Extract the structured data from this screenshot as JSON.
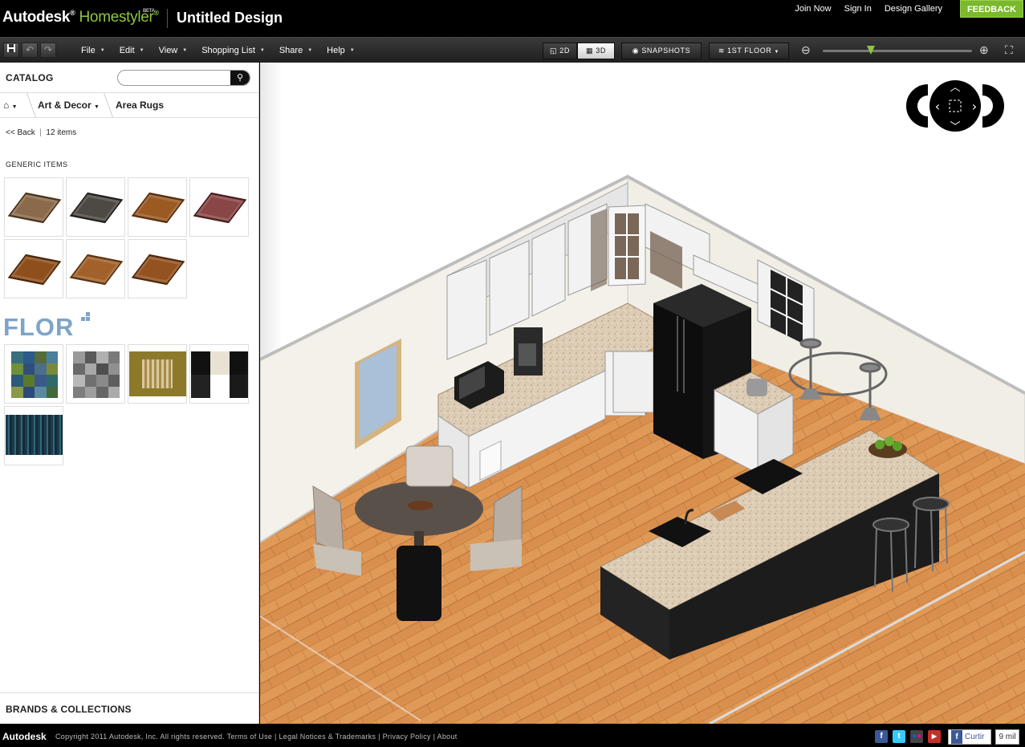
{
  "header": {
    "brand_autodesk": "Autodesk",
    "brand_product": "Homestyler",
    "brand_beta": "BETA",
    "document_title": "Untitled Design",
    "links": [
      "Join Now",
      "Sign In",
      "Design Gallery"
    ],
    "feedback_label": "FEEDBACK"
  },
  "menubar": {
    "menus": [
      "File",
      "Edit",
      "View",
      "Shopping List",
      "Share",
      "Help"
    ],
    "view_2d_label": "2D",
    "view_3d_label": "3D",
    "active_view": "3D",
    "snapshots_label": "SNAPSHOTS",
    "floor_label": "1ST FLOOR",
    "zoom_level": 0.32
  },
  "catalog": {
    "title": "CATALOG",
    "search": {
      "value": "",
      "placeholder": ""
    },
    "breadcrumb": [
      "Art & Decor",
      "Area Rugs"
    ],
    "back_label": "<< Back",
    "item_count_label": "12 items",
    "generic_section_label": "GENERIC ITEMS",
    "generic_rugs": [
      {
        "color": "#8a6a4a",
        "border": "#4a3422"
      },
      {
        "color": "#4d4a44",
        "border": "#23201c"
      },
      {
        "color": "#9a5a22",
        "border": "#5a2e10"
      },
      {
        "color": "#8a4646",
        "border": "#4a2020"
      },
      {
        "color": "#8e4f1c",
        "border": "#4c270b"
      },
      {
        "color": "#a2612a",
        "border": "#5d3412"
      },
      {
        "color": "#93521f",
        "border": "#4f2a0e"
      }
    ],
    "flor_label": "FLOR",
    "brands_label": "BRANDS & COLLECTIONS"
  },
  "viewport": {
    "colors": {
      "floor": "#d9904f",
      "wall": "#f4f1ea",
      "cabinet": "#f2f2f2",
      "counter": "#d9c9b3",
      "fridge": "#111111",
      "island": "#1c1c1c"
    }
  },
  "footer": {
    "brand": "Autodesk",
    "copyright": "Copyright 2011 Autodesk, Inc. All rights reserved.",
    "links": [
      "Terms of Use",
      "Legal Notices & Trademarks",
      "Privacy Policy",
      "About"
    ],
    "social_icons": [
      "facebook-icon",
      "twitter-icon",
      "flickr-icon",
      "youtube-icon"
    ],
    "like_label": "Curtir",
    "like_count": "9 mil"
  }
}
